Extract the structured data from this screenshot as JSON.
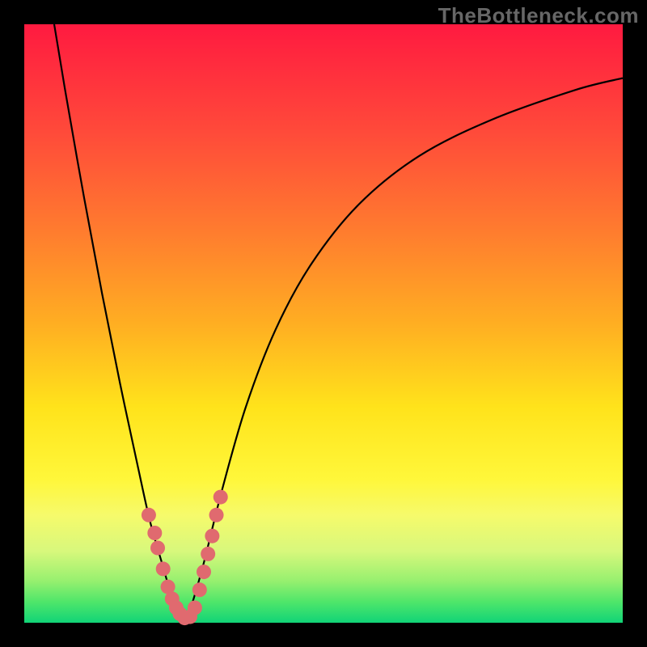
{
  "watermark": "TheBottleneck.com",
  "chart_data": {
    "type": "line",
    "title": "",
    "xlabel": "",
    "ylabel": "",
    "xlim": [
      0,
      100
    ],
    "ylim": [
      0,
      100
    ],
    "grid": false,
    "legend": false,
    "background_gradient": [
      "#ff1a40",
      "#ffae22",
      "#fff73a",
      "#11d477"
    ],
    "series": [
      {
        "name": "left-curve",
        "color": "#000000",
        "x": [
          5,
          7,
          10,
          13,
          16,
          19,
          21,
          23,
          24.5,
          26,
          27
        ],
        "y": [
          100,
          88,
          71,
          55,
          40,
          26,
          17,
          10,
          5,
          2,
          0
        ]
      },
      {
        "name": "right-curve",
        "color": "#000000",
        "x": [
          27,
          28,
          30,
          33,
          37,
          42,
          48,
          56,
          66,
          78,
          92,
          100
        ],
        "y": [
          0,
          3,
          10,
          22,
          36,
          49,
          60,
          70,
          78,
          84,
          89,
          91
        ]
      }
    ],
    "markers": {
      "name": "highlight-dots",
      "color": "#e06a6f",
      "radius_px": 9,
      "points": [
        {
          "x": 20.8,
          "y": 18.0
        },
        {
          "x": 21.8,
          "y": 15.0
        },
        {
          "x": 22.3,
          "y": 12.5
        },
        {
          "x": 23.2,
          "y": 9.0
        },
        {
          "x": 24.0,
          "y": 6.0
        },
        {
          "x": 24.7,
          "y": 4.0
        },
        {
          "x": 25.4,
          "y": 2.5
        },
        {
          "x": 26.0,
          "y": 1.5
        },
        {
          "x": 26.8,
          "y": 0.8
        },
        {
          "x": 27.7,
          "y": 1.0
        },
        {
          "x": 28.5,
          "y": 2.5
        },
        {
          "x": 29.3,
          "y": 5.5
        },
        {
          "x": 30.0,
          "y": 8.5
        },
        {
          "x": 30.7,
          "y": 11.5
        },
        {
          "x": 31.4,
          "y": 14.5
        },
        {
          "x": 32.1,
          "y": 18.0
        },
        {
          "x": 32.8,
          "y": 21.0
        }
      ]
    }
  }
}
